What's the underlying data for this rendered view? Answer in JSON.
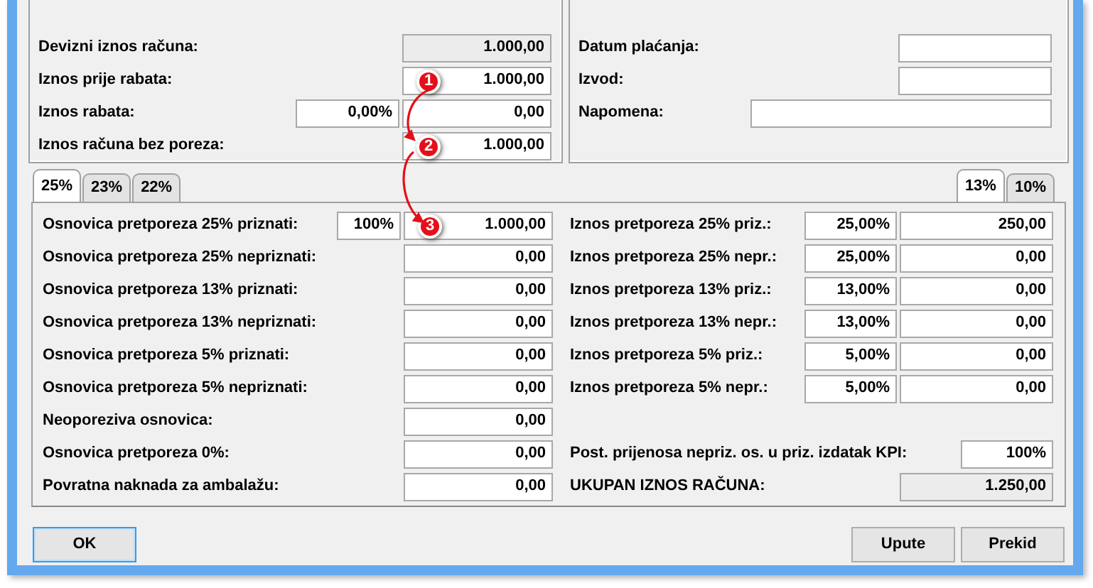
{
  "top_left": {
    "rows": [
      {
        "label": "Devizni iznos računa:",
        "fields": [
          {
            "kind": "amount",
            "value": "1.000,00",
            "readonly": true
          }
        ]
      },
      {
        "label": "Iznos prije rabata:",
        "fields": [
          {
            "kind": "amount",
            "value": "1.000,00",
            "readonly": false,
            "marker": "1"
          }
        ]
      },
      {
        "label": "Iznos rabata:",
        "fields": [
          {
            "kind": "percent",
            "value": "0,00%",
            "readonly": false
          },
          {
            "kind": "amount",
            "value": "0,00",
            "readonly": false
          }
        ]
      },
      {
        "label": "Iznos računa bez poreza:",
        "fields": [
          {
            "kind": "amount",
            "value": "1.000,00",
            "readonly": false,
            "marker": "2"
          }
        ]
      }
    ]
  },
  "top_right": {
    "rows": [
      {
        "label": "Datum plaćanja:",
        "fields": [
          {
            "kind": "amount",
            "readonly": false
          }
        ]
      },
      {
        "label": "Izvod:",
        "fields": [
          {
            "kind": "amount",
            "readonly": false
          }
        ]
      },
      {
        "label": "Napomena:",
        "fields": [
          {
            "kind": "note",
            "readonly": false
          }
        ]
      }
    ]
  },
  "left_tabs": [
    {
      "label": "25%",
      "selected": true
    },
    {
      "label": "23%",
      "selected": false
    },
    {
      "label": "22%",
      "selected": false
    }
  ],
  "right_tabs": [
    {
      "label": "13%",
      "selected": true
    },
    {
      "label": "10%",
      "selected": false
    }
  ],
  "base_rows": [
    {
      "label": "Osnovica pretporeza 25% priznati:",
      "fields": [
        {
          "kind": "percent",
          "value": "100%",
          "readonly": false
        },
        {
          "kind": "amount",
          "value": "1.000,00",
          "readonly": false,
          "marker": "3"
        }
      ]
    },
    {
      "label": "Osnovica pretporeza 25% nepriznati:",
      "fields": [
        {
          "kind": "amount",
          "value": "0,00",
          "readonly": false
        }
      ]
    },
    {
      "label": "Osnovica pretporeza 13% priznati:",
      "fields": [
        {
          "kind": "amount",
          "value": "0,00",
          "readonly": false
        }
      ]
    },
    {
      "label": "Osnovica pretporeza 13% nepriznati:",
      "fields": [
        {
          "kind": "amount",
          "value": "0,00",
          "readonly": false
        }
      ]
    },
    {
      "label": "Osnovica pretporeza 5% priznati:",
      "fields": [
        {
          "kind": "amount",
          "value": "0,00",
          "readonly": false
        }
      ]
    },
    {
      "label": "Osnovica pretporeza 5% nepriznati:",
      "fields": [
        {
          "kind": "amount",
          "value": "0,00",
          "readonly": false
        }
      ]
    },
    {
      "label": "Neoporeziva osnovica:",
      "fields": [
        {
          "kind": "amount",
          "value": "0,00",
          "readonly": false
        }
      ]
    },
    {
      "label": "Osnovica pretporeza 0%:",
      "fields": [
        {
          "kind": "amount",
          "value": "0,00",
          "readonly": false
        }
      ]
    },
    {
      "label": "Povratna naknada za ambalažu:",
      "fields": [
        {
          "kind": "amount",
          "value": "0,00",
          "readonly": false
        }
      ]
    }
  ],
  "tax_rows": [
    {
      "label": "Iznos pretporeza 25% priz.:",
      "fields": [
        {
          "kind": "percent",
          "value": "25,00%",
          "readonly": false
        },
        {
          "kind": "amount",
          "value": "250,00",
          "readonly": false
        }
      ]
    },
    {
      "label": "Iznos pretporeza 25% nepr.:",
      "fields": [
        {
          "kind": "percent",
          "value": "25,00%",
          "readonly": false
        },
        {
          "kind": "amount",
          "value": "0,00",
          "readonly": false
        }
      ]
    },
    {
      "label": "Iznos pretporeza 13% priz.:",
      "fields": [
        {
          "kind": "percent",
          "value": "13,00%",
          "readonly": false
        },
        {
          "kind": "amount",
          "value": "0,00",
          "readonly": false
        }
      ]
    },
    {
      "label": "Iznos pretporeza 13% nepr.:",
      "fields": [
        {
          "kind": "percent",
          "value": "13,00%",
          "readonly": false
        },
        {
          "kind": "amount",
          "value": "0,00",
          "readonly": false
        }
      ]
    },
    {
      "label": "Iznos pretporeza 5% priz.:",
      "fields": [
        {
          "kind": "percent",
          "value": "5,00%",
          "readonly": false
        },
        {
          "kind": "amount",
          "value": "0,00",
          "readonly": false
        }
      ]
    },
    {
      "label": "Iznos pretporeza 5% nepr.:",
      "fields": [
        {
          "kind": "percent",
          "value": "5,00%",
          "readonly": false
        },
        {
          "kind": "amount",
          "value": "0,00",
          "readonly": false
        }
      ]
    }
  ],
  "summary_rows": [
    {
      "label": "Post. prijenosa nepriz. os. u priz. izdatak KPI:",
      "fields": [
        {
          "kind": "short",
          "value": "100%",
          "readonly": false
        }
      ]
    },
    {
      "label": "UKUPAN IZNOS RAČUNA:",
      "fields": [
        {
          "kind": "amount",
          "value": "1.250,00",
          "readonly": true
        }
      ]
    }
  ],
  "left_buttons": [
    {
      "label": "OK",
      "default": true
    }
  ],
  "right_buttons": [
    {
      "label": "Upute",
      "default": false
    },
    {
      "label": "Prekid",
      "default": false
    }
  ]
}
